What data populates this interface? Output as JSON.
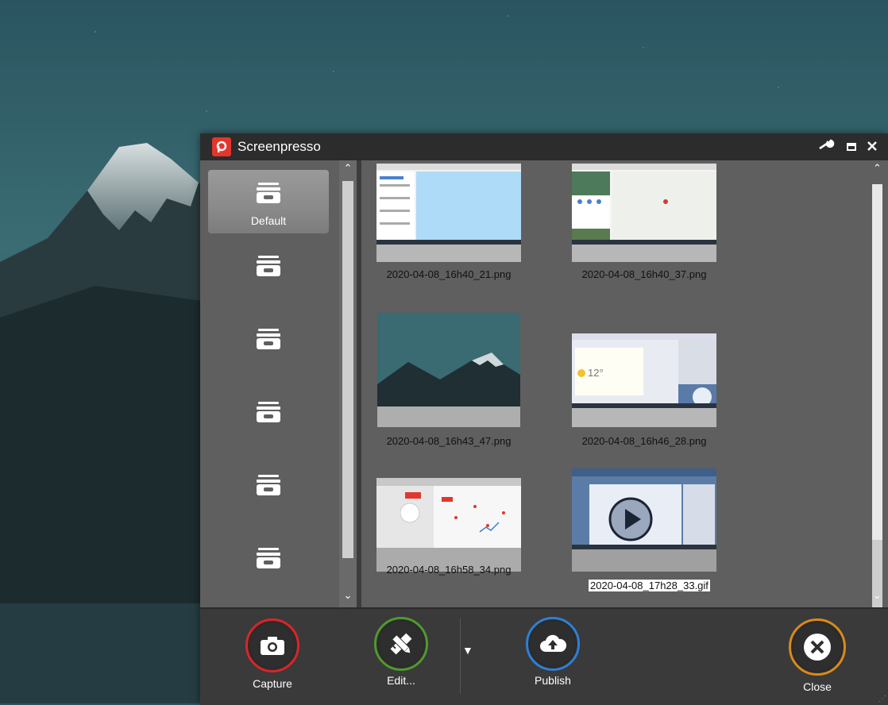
{
  "app": {
    "title": "Screenpresso",
    "logo_letter": "p",
    "accent": "#e2362e"
  },
  "titlebar_icons": [
    "wrench-icon",
    "maximize-icon",
    "close-icon"
  ],
  "folders": [
    {
      "label": "Default",
      "active": true,
      "blurred": false
    },
    {
      "label": "",
      "active": false,
      "blurred": true
    },
    {
      "label": "",
      "active": false,
      "blurred": true
    },
    {
      "label": "",
      "active": false,
      "blurred": true
    },
    {
      "label": "",
      "active": false,
      "blurred": true
    },
    {
      "label": "",
      "active": false,
      "blurred": true
    }
  ],
  "files": [
    {
      "name": "2020-04-08_16h40_21.png",
      "kind": "screenshot",
      "selected": false
    },
    {
      "name": "2020-04-08_16h40_37.png",
      "kind": "screenshot",
      "selected": false
    },
    {
      "name": "2020-04-08_16h43_47.png",
      "kind": "landscape",
      "selected": false
    },
    {
      "name": "2020-04-08_16h46_28.png",
      "kind": "screenshot",
      "selected": false
    },
    {
      "name": "2020-04-08_16h58_34.png",
      "kind": "screenshot",
      "selected": false
    },
    {
      "name": "2020-04-08_17h28_33.gif",
      "kind": "video",
      "selected": true
    }
  ],
  "actions": {
    "capture": {
      "label": "Capture",
      "color": "#d9252a"
    },
    "edit": {
      "label": "Edit...",
      "color": "#4f9a2e"
    },
    "publish": {
      "label": "Publish",
      "color": "#2f7fd4"
    },
    "close": {
      "label": "Close",
      "color": "#d98a1b"
    }
  }
}
